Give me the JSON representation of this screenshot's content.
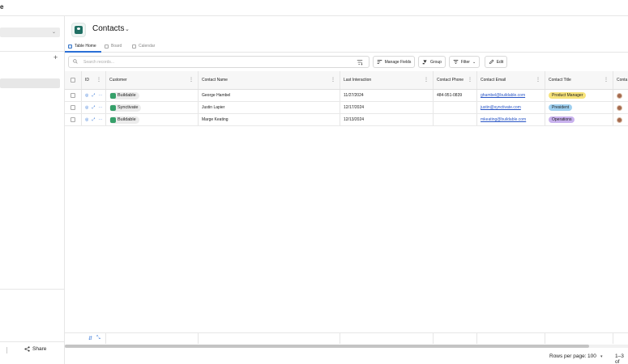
{
  "topbar": {
    "fragment": "e"
  },
  "page": {
    "title": "Contacts"
  },
  "tabs": [
    {
      "label": "Table Home",
      "active": true,
      "icon": "table-icon"
    },
    {
      "label": "Board",
      "active": false,
      "icon": "board-icon"
    },
    {
      "label": "Calendar",
      "active": false,
      "icon": "calendar-icon"
    }
  ],
  "toolbar": {
    "search_placeholder": "Search records...",
    "manage_fields": "Manage Fields",
    "group": "Group",
    "filter": "Filter",
    "edit": "Edit"
  },
  "table": {
    "columns": [
      "ID",
      "Customer",
      "Contact Name",
      "Last Interaction",
      "Contact Phone",
      "Contact Email",
      "Contact Title",
      "Conta"
    ],
    "rows": [
      {
        "customer": "Buildable",
        "name": "George Hambel",
        "last": "11/27/2024",
        "phone": "484-951-0839",
        "email": "ghambel@buildable.com",
        "title": "Product Manager",
        "title_color": "#f7e37a"
      },
      {
        "customer": "Synctivate",
        "name": "Justin Lapier",
        "last": "12/17/2024",
        "phone": "",
        "email": "justin@synctivate.com",
        "title": "President",
        "title_color": "#9fd0f0"
      },
      {
        "customer": "Buildable",
        "name": "Marge Keating",
        "last": "12/13/2024",
        "phone": "",
        "email": "mkeating@buildable.com",
        "title": "Operations",
        "title_color": "#c9b2ee"
      }
    ]
  },
  "sidebar": {
    "share_label": "Share"
  },
  "pagination": {
    "rows_per_page_label": "Rows per page:",
    "rows_per_page_value": "100",
    "range_text": "1–3 of"
  }
}
